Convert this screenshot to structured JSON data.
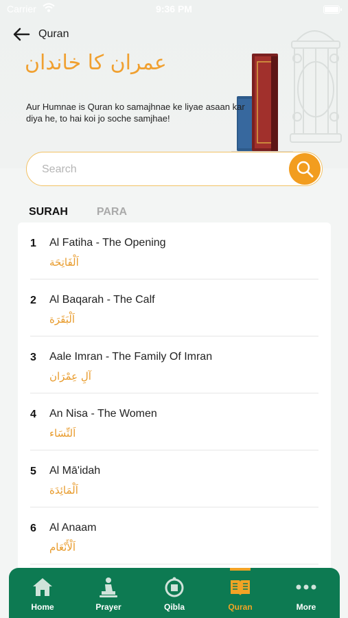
{
  "status_bar": {
    "carrier": "Carrier",
    "time": "9:36 PM"
  },
  "header": {
    "back_icon": "arrow-left-icon",
    "title": "Quran",
    "urdu_title": "عمران کا خاندان",
    "tagline": "Aur Humnae is Quran ko samajhnae ke liyae asaan kar diya he, to hai koi jo soche samjhae!"
  },
  "search": {
    "placeholder": "Search",
    "icon": "search-icon"
  },
  "tabs": [
    {
      "label": "SURAH",
      "active": true
    },
    {
      "label": "PARA",
      "active": false
    }
  ],
  "surahs": [
    {
      "number": "1",
      "name": "Al Fatiha - The Opening",
      "arabic": "اَلْفَاتِحَة"
    },
    {
      "number": "2",
      "name": "Al Baqarah - The Calf",
      "arabic": "اَلْبَقَرَة"
    },
    {
      "number": "3",
      "name": "Aale Imran - The Family Of Imran",
      "arabic": "آلِ عِمْرَان"
    },
    {
      "number": "4",
      "name": "An Nisa - The Women",
      "arabic": "اَلنِّسَاء"
    },
    {
      "number": "5",
      "name": "Al Mā'idah",
      "arabic": "اَلْمَائِدَة"
    },
    {
      "number": "6",
      "name": "Al Anaam",
      "arabic": "اَلْأَنْعَام"
    }
  ],
  "bottom_nav": [
    {
      "label": "Home",
      "icon": "home-icon",
      "active": false
    },
    {
      "label": "Prayer",
      "icon": "prayer-icon",
      "active": false
    },
    {
      "label": "Qibla",
      "icon": "compass-icon",
      "active": false
    },
    {
      "label": "Quran",
      "icon": "quran-book-icon",
      "active": true
    },
    {
      "label": "More",
      "icon": "more-dots-icon",
      "active": false
    }
  ],
  "colors": {
    "accent": "#f29d1f",
    "brand_green": "#0d7a52"
  }
}
